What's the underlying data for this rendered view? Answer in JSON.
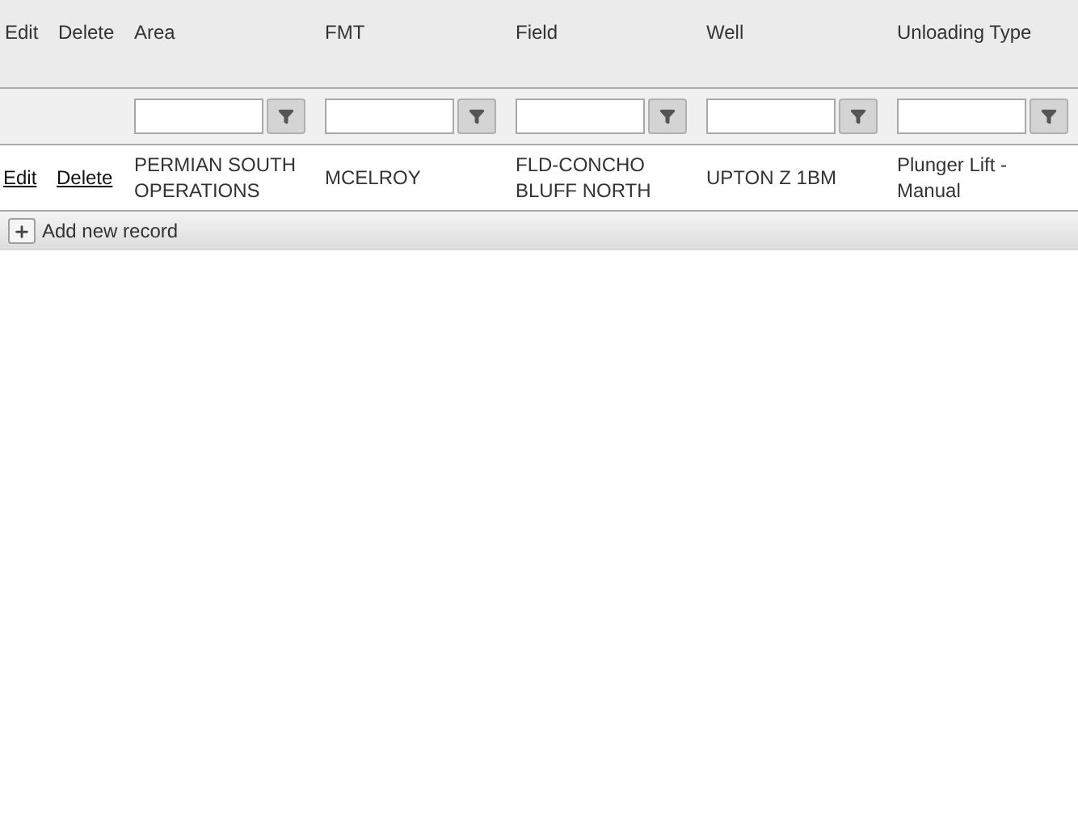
{
  "table": {
    "columns": [
      {
        "label": "Edit",
        "filter": false
      },
      {
        "label": "Delete",
        "filter": false
      },
      {
        "label": "Area",
        "filter": true
      },
      {
        "label": "FMT",
        "filter": true
      },
      {
        "label": "Field",
        "filter": true
      },
      {
        "label": "Well",
        "filter": true
      },
      {
        "label": "Unloading Type",
        "filter": true
      }
    ],
    "rows": [
      {
        "cells": [
          {
            "kind": "link",
            "text": "Edit"
          },
          {
            "kind": "link",
            "text": "Delete"
          },
          {
            "kind": "text",
            "text": "PERMIAN SOUTH OPERATIONS"
          },
          {
            "kind": "text",
            "text": "MCELROY"
          },
          {
            "kind": "text",
            "text": "FLD-CONCHO BLUFF NORTH"
          },
          {
            "kind": "text",
            "text": "UPTON Z 1BM"
          },
          {
            "kind": "text",
            "text": "Plunger Lift - Manual"
          }
        ]
      }
    ]
  },
  "footer": {
    "add_label": "Add new record"
  }
}
